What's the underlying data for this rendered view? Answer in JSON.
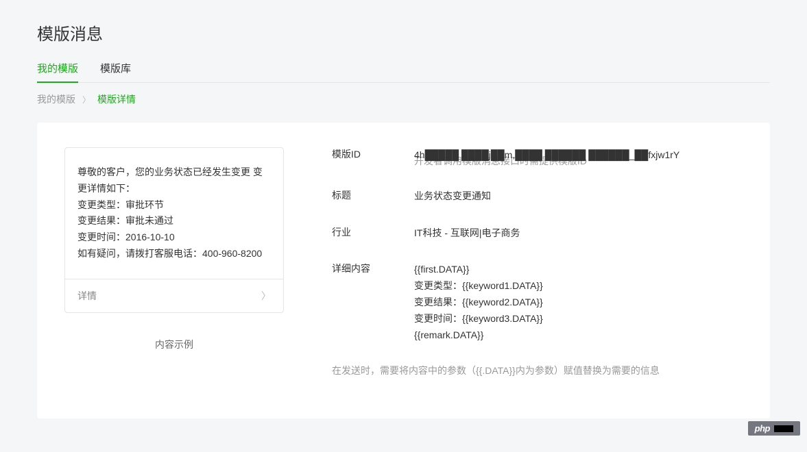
{
  "page": {
    "title": "模版消息"
  },
  "tabs": {
    "my_templates": "我的模版",
    "template_library": "模版库"
  },
  "breadcrumb": {
    "root": "我的模版",
    "current": "模版详情"
  },
  "preview": {
    "line1": "尊敬的客户，您的业务状态已经发生变更 变更详情如下：",
    "line2": "变更类型：审批环节",
    "line3": "变更结果：审批未通过",
    "line4": "变更时间：2016-10-10",
    "line5": "如有疑问，请拨打客服电话：400-960-8200",
    "footer_label": "详情",
    "example_label": "内容示例"
  },
  "detail": {
    "template_id": {
      "label": "模版ID",
      "value": "4h█████ ████j██m,████ ██████ ██████_██fxjw1rY",
      "helper": "开发者调用模版消息接口时需提供模版ID"
    },
    "title": {
      "label": "标题",
      "value": "业务状态变更通知"
    },
    "industry": {
      "label": "行业",
      "value": "IT科技 - 互联网|电子商务"
    },
    "content": {
      "label": "详细内容",
      "l1": "{{first.DATA}}",
      "l2": "变更类型：{{keyword1.DATA}}",
      "l3": "变更结果：{{keyword2.DATA}}",
      "l4": "变更时间：{{keyword3.DATA}}",
      "l5": "{{remark.DATA}}"
    },
    "footer_helper": "在发送时，需要将内容中的参数（{{.DATA}}内为参数）赋值替换为需要的信息"
  },
  "watermark": {
    "label": "php"
  }
}
